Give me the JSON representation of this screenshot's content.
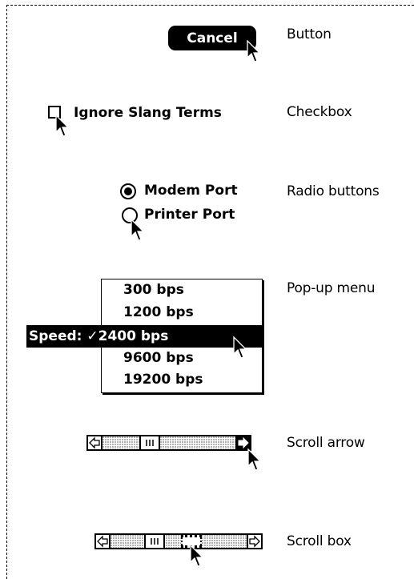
{
  "labels": {
    "button": "Button",
    "checkbox": "Checkbox",
    "radio": "Radio buttons",
    "popup": "Pop-up menu",
    "scroll_arrow": "Scroll arrow",
    "scroll_box": "Scroll box"
  },
  "button": {
    "label": "Cancel"
  },
  "checkbox": {
    "label": "Ignore Slang Terms",
    "checked": false
  },
  "radio": {
    "items": [
      {
        "label": "Modem Port",
        "selected": true
      },
      {
        "label": "Printer Port",
        "selected": false
      }
    ]
  },
  "popup": {
    "field_label": "Speed:",
    "options": [
      "300 bps",
      "1200 bps",
      "2400 bps",
      "9600 bps",
      "19200 bps"
    ],
    "selected": "✓2400 bps"
  },
  "scroll": {
    "arrow_demo": {
      "left_arrow": "left-arrow-icon",
      "right_arrow": "right-arrow-icon"
    },
    "box_demo": {
      "left_arrow": "left-arrow-icon",
      "right_arrow": "right-arrow-icon"
    }
  }
}
